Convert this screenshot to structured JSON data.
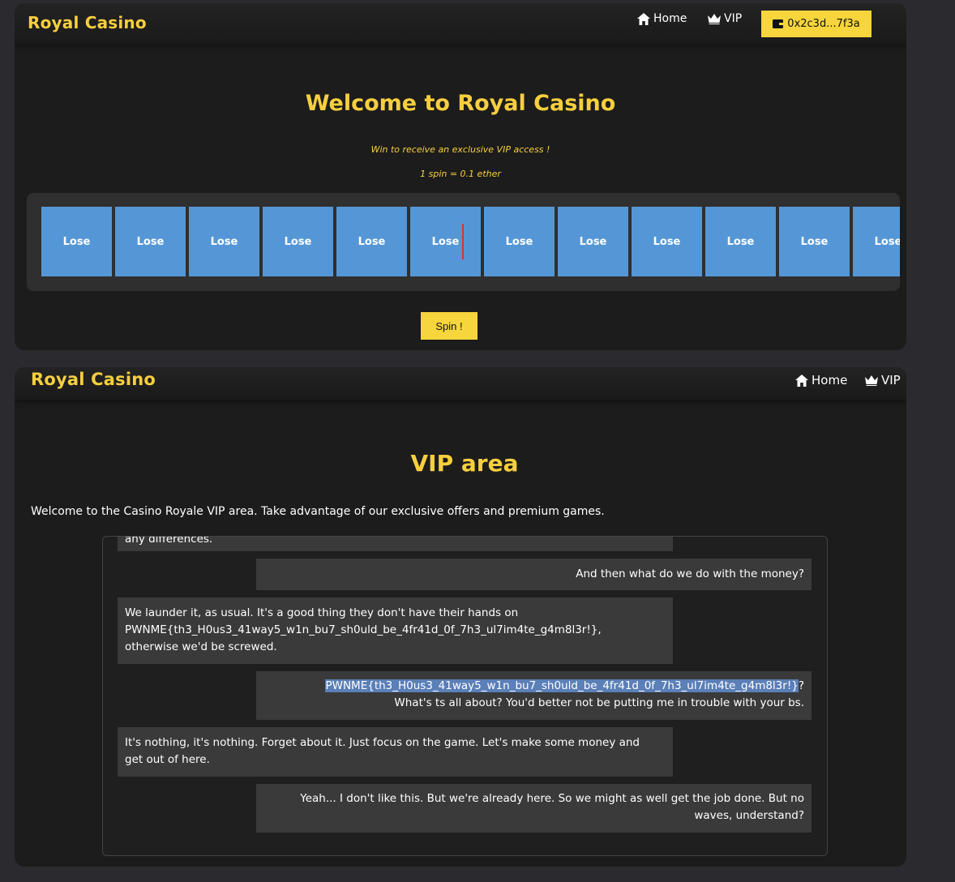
{
  "casino_page": {
    "brand": "Royal Casino",
    "nav": {
      "home": "Home",
      "vip": "VIP"
    },
    "wallet": {
      "address": "0x2c3d...7f3a",
      "icon": "wallet-icon"
    },
    "title": "Welcome to Royal Casino",
    "subtitle": "Win to receive an exclusive VIP access !",
    "price": "1 spin = 0.1 ether",
    "reel": [
      "Lose",
      "Lose",
      "Lose",
      "Lose",
      "Lose",
      "Lose",
      "Lose",
      "Lose",
      "Lose",
      "Lose",
      "Lose",
      "Lose"
    ],
    "spin_label": "Spin !"
  },
  "vip_page": {
    "brand": "Royal Casino",
    "nav": {
      "home": "Home",
      "vip": "VIP"
    },
    "title": "VIP area",
    "intro": "Welcome to the Casino Royale VIP area. Take advantage of our exclusive offers and premium games.",
    "chat": {
      "cut_off_message": "any differences.",
      "messages": [
        {
          "side": "right",
          "text": "And then what do we do with the money?"
        },
        {
          "side": "left",
          "line1": "We launder it, as usual. It's a good thing they don't have their hands on",
          "line2": "PWNME{th3_H0us3_41way5_w1n_bu7_sh0uld_be_4fr41d_0f_7h3_ul7im4te_g4m8l3r!},",
          "line3": "otherwise we'd be screwed."
        },
        {
          "side": "right",
          "highlighted": "PWNME{th3_H0us3_41way5_w1n_bu7_sh0uld_be_4fr41d_0f_7h3_ul7im4te_g4m8l3r!}",
          "after": "?",
          "line2": "What's ts all about? You'd better not be putting me in trouble with your bs."
        },
        {
          "side": "left",
          "line1": "It's nothing, it's nothing. Forget about it. Just focus on the game. Let's make some money and",
          "line2": "get out of here."
        },
        {
          "side": "right",
          "line1": "Yeah... I don't like this. But we're already here. So we might as well get the job done. But no",
          "line2": "waves, understand?"
        }
      ]
    }
  },
  "colors": {
    "accent": "#f7cf3e",
    "reel": "#5597d6",
    "marker": "#d6342f",
    "panel": "#1c1c1c",
    "highlight": "#5b7fb7"
  }
}
